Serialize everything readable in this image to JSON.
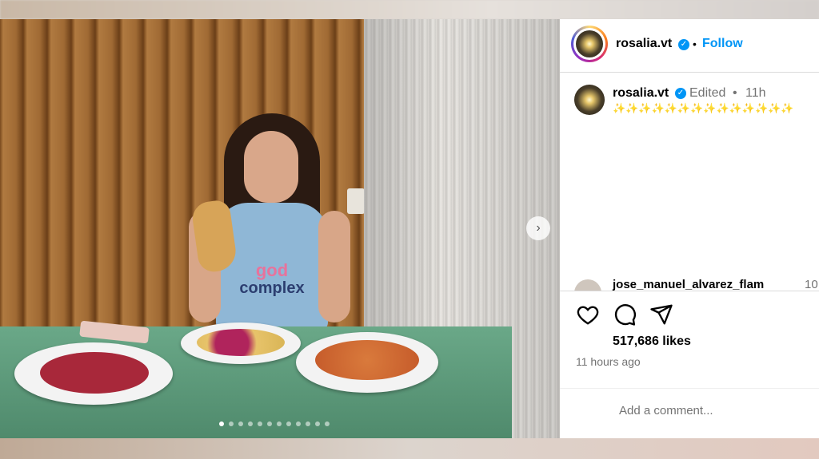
{
  "post": {
    "username": "rosalia.vt",
    "follow_label": "Follow",
    "caption_username": "rosalia.vt",
    "edited_label": "Edited",
    "time_short": "11h",
    "caption": "✨✨✨✨✨✨✨✨✨✨✨✨✨✨",
    "shirt_line1": "god",
    "shirt_line2": "complex",
    "comment_preview": {
      "username": "jose_manuel_alvarez_flam",
      "time": "10"
    },
    "likes": "517,686 likes",
    "time_ago": "11 hours ago",
    "add_comment_placeholder": "Add a comment...",
    "carousel": {
      "total": 12,
      "active": 0
    }
  },
  "colors": {
    "accent": "#0095f6",
    "caption_sparkle": "#d4a017"
  },
  "icons": [
    "heart-icon",
    "comment-icon",
    "share-icon",
    "verified-badge-icon",
    "chevron-right-icon"
  ]
}
